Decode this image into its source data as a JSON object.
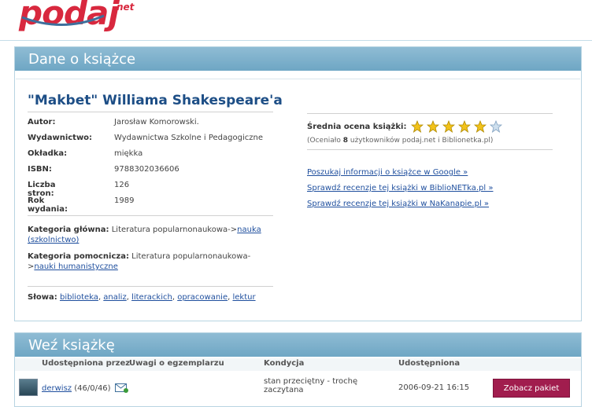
{
  "brand": {
    "name": "podaj",
    "suffix": "net"
  },
  "panel1": {
    "heading": "Dane o książce"
  },
  "book": {
    "title": "\"Makbet\" Williama Shakespeare'a",
    "fields": [
      {
        "label": "Autor:",
        "value": "Jarosław Komorowski."
      },
      {
        "label": "Wydawnictwo:",
        "value": "Wydawnictwa Szkolne i Pedagogiczne"
      },
      {
        "label": "Okładka:",
        "value": "miękka"
      },
      {
        "label": "ISBN:",
        "value": "9788302036606"
      },
      {
        "label": "Liczba stron:",
        "value": "126"
      },
      {
        "label": "Rok wydania:",
        "value": "1989"
      }
    ],
    "main_category": {
      "label": "Kategoria główna:",
      "prefix": "Literatura popularnonaukowa->",
      "link": "nauka (szkolnictwo)"
    },
    "sub_category": {
      "label": "Kategoria pomocnicza:",
      "prefix": "Literatura popularnonaukowa->",
      "link": "nauki humanistyczne"
    },
    "keywords": {
      "label": "Słowa:",
      "items": [
        "biblioteka",
        "analiz",
        "literackich",
        "opracowanie",
        "lektur"
      ]
    }
  },
  "rating": {
    "label": "Średnia ocena książki:",
    "stars_filled": 5,
    "stars_total": 6,
    "sub_prefix": "(Oceniało ",
    "count": "8",
    "sub_suffix": " użytkowników podaj.net i Biblionetka.pl)"
  },
  "links": [
    "Poszukaj informacji o książce w Google »",
    "Sprawdź recenzje tej książki w BiblioNETka.pl »",
    "Sprawdź recenzje tej książki w NaKanapie.pl »"
  ],
  "panel2": {
    "heading": "Weź książkę",
    "columns": [
      "Udostępniona przez",
      "Uwagi o egzemplarzu",
      "Kondycja",
      "Udostępniona"
    ],
    "row": {
      "user": "derwisz",
      "user_stats": "(46/0/46)",
      "condition": "stan przeciętny - trochę zaczytana",
      "date": "2006-09-21 16:15",
      "button": "Zobacz pakiet"
    }
  },
  "colors": {
    "brand": "#d8283e",
    "header": "#7fb2cc",
    "link": "#1f4f9e",
    "button": "#a11d4e"
  }
}
